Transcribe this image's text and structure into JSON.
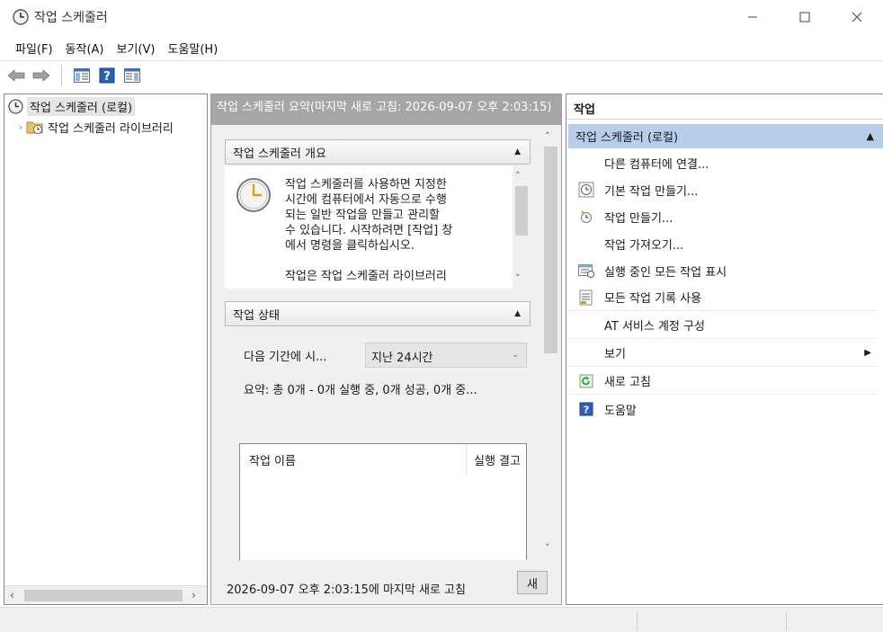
{
  "window": {
    "title": "작업 스케줄러"
  },
  "menu": [
    "파일(F)",
    "동작(A)",
    "보기(V)",
    "도움말(H)"
  ],
  "toolbar": {
    "icons": [
      "back-arrow-icon",
      "forward-arrow-icon",
      "show-hide-tree-icon",
      "help-icon",
      "show-hide-action-pane-icon"
    ]
  },
  "tree": {
    "root": "작업 스케줄러 (로컬)",
    "child": "작업 스케줄러 라이브러리"
  },
  "center": {
    "header": "작업 스케줄러 요약(마지막 새로 고침: 2026-09-07 오후 2:03:15)",
    "overview": {
      "title": "작업 스케줄러 개요",
      "lines": [
        "작업 스케줄러를 사용하면 지정한",
        "시간에 컴퓨터에서 자동으로 수행",
        "되는 일반 작업을 만들고 관리할",
        "수 있습니다. 시작하려면 [작업] 창",
        "에서 명령을 클릭하십시오.",
        "",
        "작업은 작업 스케줄러 라이브러리"
      ]
    },
    "status": {
      "title": "작업 상태",
      "period_label": "다음 기간에 시...",
      "period_value": "지난 24시간",
      "summary": "요약: 총 0개 - 0개 실행 중, 0개 성공, 0개 중...",
      "columns": [
        "작업 이름",
        "실행 결고"
      ]
    },
    "footer": {
      "last_refresh": "2026-09-07 오후 2:03:15에 마지막 새로 고침",
      "refresh_button": "새"
    }
  },
  "actions": {
    "title": "작업",
    "group": "작업 스케줄러 (로컬)",
    "items": [
      {
        "label": "다른 컴퓨터에 연결...",
        "icon": ""
      },
      {
        "label": "기본 작업 만들기...",
        "icon": "clock-wizard-icon"
      },
      {
        "label": "작업 만들기...",
        "icon": "create-task-icon"
      },
      {
        "label": "작업 가져오기...",
        "icon": ""
      },
      {
        "label": "실행 중인 모든 작업 표시",
        "icon": "running-tasks-icon"
      },
      {
        "label": "모든 작업 기록 사용",
        "icon": "history-icon"
      },
      {
        "label": "AT 서비스 계정 구성",
        "icon": ""
      },
      {
        "label": "보기",
        "icon": ""
      },
      {
        "label": "새로 고침",
        "icon": "refresh-icon"
      },
      {
        "label": "도움말",
        "icon": "help-icon"
      }
    ]
  },
  "colors": {
    "selection": "#b8cde8",
    "header_gray": "#a6a6a6",
    "help_blue": "#2b5fb4"
  }
}
